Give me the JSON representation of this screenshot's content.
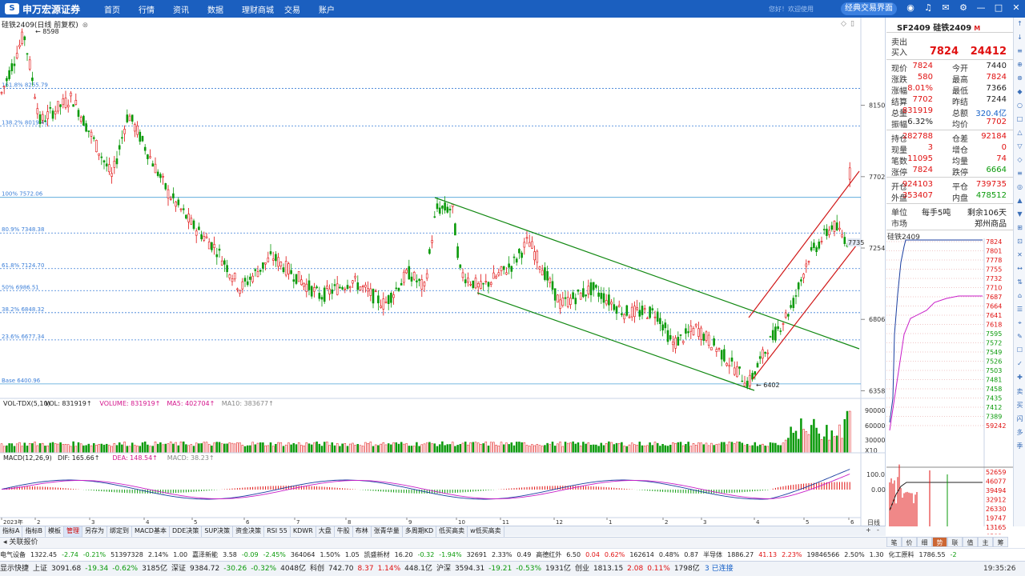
{
  "topbar": {
    "brand": "申万宏源证券",
    "brand_sub": "SHENWAN HONGYUAN SECURITIES",
    "menu": [
      "首页",
      "行情",
      "资讯",
      "数据",
      "理财商城",
      "交易",
      "账户"
    ],
    "hint": "您好！欢迎使用",
    "classic_button": "经典交易界面",
    "icons": [
      "message-icon",
      "headset-icon",
      "mail-icon",
      "settings-icon",
      "minimize-icon",
      "maximize-icon",
      "close-icon"
    ]
  },
  "chart": {
    "title": "硅铁2409(日线 前复权)",
    "close_mark": "⊗",
    "high_label": "8598",
    "low_label": "6402",
    "last_label": "7735",
    "fib_levels": [
      {
        "label": "161.8% 8255.79",
        "value": 8255.79
      },
      {
        "label": "138.2% 8019.41",
        "value": 8019.41
      },
      {
        "label": "100% 7572.06",
        "value": 7572.06
      },
      {
        "label": "80.9% 7348.38",
        "value": 7348.38
      },
      {
        "label": "61.8% 7124.70",
        "value": 7124.7
      },
      {
        "label": "50% 6986.51",
        "value": 6986.51
      },
      {
        "label": "38.2% 6848.32",
        "value": 6848.32
      },
      {
        "label": "23.6% 6677.34",
        "value": 6677.34
      },
      {
        "label": "Base 6400.96",
        "value": 6400.96
      }
    ],
    "y_ticks": [
      "8150",
      "7702",
      "7254",
      "6806",
      "6358"
    ],
    "vol_title": "VOL-TDX(5,10)",
    "vol_values": [
      {
        "text": "VOL: 831919↑",
        "color": "#222222"
      },
      {
        "text": "VOLUME: 831919↑",
        "color": "#d4148c"
      },
      {
        "text": "MA5: 402704↑",
        "color": "#d4148c"
      },
      {
        "text": "MA10: 383677↑",
        "color": "#888888"
      }
    ],
    "vol_ticks": [
      "90000",
      "60000",
      "30000",
      "X10"
    ],
    "macd_title": "MACD(12,26,9)",
    "macd_values": [
      {
        "text": "DIF: 165.66↑",
        "color": "#222222"
      },
      {
        "text": "DEA: 148.54↑",
        "color": "#d4148c"
      },
      {
        "text": "MACD: 38.23↑",
        "color": "#888888"
      }
    ],
    "macd_ticks": [
      "100.0",
      "0.00"
    ],
    "x_labels": [
      "2023年",
      "2",
      "3",
      "4",
      "5",
      "6",
      "7",
      "8",
      "9",
      "10",
      "11",
      "12",
      "1",
      "2",
      "3",
      "4",
      "5",
      "6"
    ],
    "x_label_end": "日线"
  },
  "quote": {
    "title": "SF2409 硅铁2409",
    "title_mark": "M",
    "sell_label": "卖出",
    "buy_label": "买入",
    "buy_price": "7824",
    "buy_volume": "24412",
    "rows1": [
      {
        "l1": "现价",
        "v1": "7824",
        "c1": "red",
        "l2": "今开",
        "v2": "7440",
        "c2": "blk"
      },
      {
        "l1": "涨跌",
        "v1": "580",
        "c1": "red",
        "l2": "最高",
        "v2": "7824",
        "c2": "red"
      },
      {
        "l1": "涨幅",
        "v1": "8.01%",
        "c1": "red",
        "l2": "最低",
        "v2": "7366",
        "c2": "blk"
      },
      {
        "l1": "结算",
        "v1": "7702",
        "c1": "red",
        "l2": "昨结",
        "v2": "7244",
        "c2": "blk"
      },
      {
        "l1": "总量",
        "v1": "831919",
        "c1": "red",
        "l2": "总额",
        "v2": "320.4亿",
        "c2": "blue"
      },
      {
        "l1": "振幅",
        "v1": "6.32%",
        "c1": "blk",
        "l2": "均价",
        "v2": "7702",
        "c2": "red"
      }
    ],
    "rows2": [
      {
        "l1": "持仓",
        "v1": "282788",
        "c1": "red",
        "l2": "仓差",
        "v2": "92184",
        "c2": "red"
      },
      {
        "l1": "现量",
        "v1": "3",
        "c1": "red",
        "l2": "增仓",
        "v2": "0",
        "c2": "red"
      },
      {
        "l1": "笔数",
        "v1": "11095",
        "c1": "red",
        "l2": "均量",
        "v2": "74",
        "c2": "red"
      },
      {
        "l1": "涨停",
        "v1": "7824",
        "c1": "red",
        "l2": "跌停",
        "v2": "6664",
        "c2": "green"
      }
    ],
    "rows3": [
      {
        "l1": "开仓",
        "v1": "924103",
        "c1": "red",
        "l2": "平仓",
        "v2": "739735",
        "c2": "red"
      },
      {
        "l1": "外盘",
        "v1": "353407",
        "c1": "red",
        "l2": "内盘",
        "v2": "478512",
        "c2": "green"
      }
    ],
    "unit_label": "单位",
    "unit_value": "每手5吨",
    "remain_label": "剩余106天",
    "market_label": "市场",
    "market_value": "郑州商品",
    "mini_title": "硅铁2409",
    "mini_prices": [
      "7824",
      "7801",
      "7778",
      "7755",
      "7732",
      "7710",
      "7687",
      "7664",
      "7641",
      "7618",
      "7595",
      "7572",
      "7549",
      "7526",
      "7503",
      "7481",
      "7458",
      "7435",
      "7412",
      "7389",
      "59242"
    ],
    "mini_vol_ticks": [
      "52659",
      "46077",
      "39494",
      "32912",
      "26330",
      "19747",
      "13165",
      "6582"
    ],
    "tabs": [
      "笔",
      "价",
      "细",
      "势",
      "联",
      "值",
      "主",
      "筹"
    ],
    "active_tab": "势"
  },
  "bottom_tabs": [
    "指标A",
    "指标B",
    "模板",
    "管理",
    "另存为",
    "绑定到",
    "MACD基本",
    "DDE决策",
    "SUP决策",
    "资金决策",
    "RSI 55",
    "KDWR",
    "大盘",
    "牛股",
    "布林",
    "张青华量",
    "多周期KD",
    "低买高卖",
    "w低买高卖"
  ],
  "active_bottom_tab": "管理",
  "zoom": [
    "+",
    "-"
  ],
  "ref_bar": "关联报价",
  "ticker": [
    "电气设备",
    "1322.45",
    "-2.74",
    "-0.21%",
    "51397328",
    "2.14%",
    "1.00",
    "嘉泽新能",
    "3.58",
    "-0.09",
    "-2.45%",
    "364064",
    "1.50%",
    "1.05",
    "凯盛新材",
    "16.20",
    "-0.32",
    "-1.94%",
    "32691",
    "2.33%",
    "0.49",
    "高德红外",
    "6.50",
    "0.04",
    "0.62%",
    "162614",
    "0.48%",
    "0.87",
    "半导体",
    "1886.27",
    "41.13",
    "2.23%",
    "19846566",
    "2.50%",
    "1.30",
    "化工原料",
    "1786.55",
    "-2"
  ],
  "statusbar": {
    "items": [
      "显示快捷",
      "上证",
      "3091.68",
      "-19.34",
      "-0.62%",
      "3185亿",
      "深证",
      "9384.72",
      "-30.26",
      "-0.32%",
      "4048亿",
      "科创",
      "742.70",
      "8.37",
      "1.14%",
      "448.1亿",
      "沪深",
      "3594.31",
      "-19.21",
      "-0.53%",
      "1931亿",
      "创业",
      "1813.15",
      "2.08",
      "0.11%",
      "1798亿"
    ],
    "done": "3 已连接",
    "time": "19:35:26"
  },
  "side_strip": [
    "↑",
    "↓",
    "≡",
    "⊕",
    "⊗",
    "◆",
    "○",
    "□",
    "△",
    "▽",
    "◇",
    "≡",
    "◎",
    "▲",
    "▼",
    "⊞",
    "⊡",
    "✕",
    "↔",
    "⇅",
    "⌂",
    "☰",
    "⌖",
    "✎",
    "☐",
    "✓",
    "✚",
    "卖",
    "买",
    "闪",
    "多",
    "季"
  ]
}
